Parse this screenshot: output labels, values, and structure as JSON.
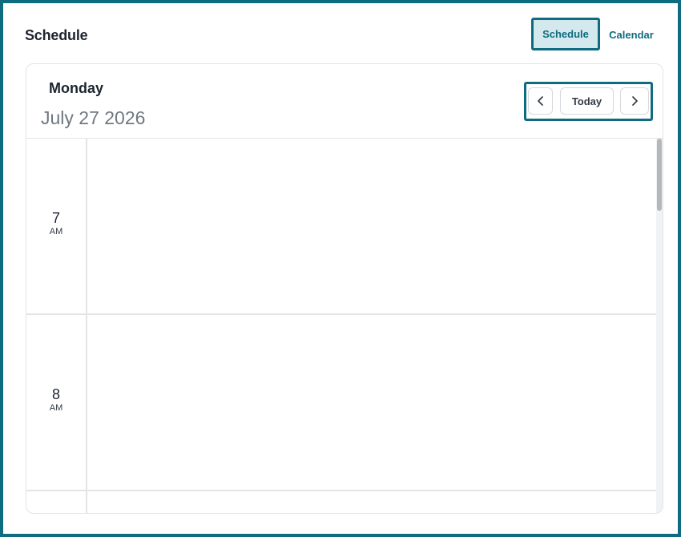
{
  "header": {
    "title": "Schedule",
    "views": {
      "schedule_label": "Schedule",
      "calendar_label": "Calendar",
      "selected": "Schedule"
    }
  },
  "day_view": {
    "day_name": "Monday",
    "date": "July 27 2026",
    "nav": {
      "prev_icon": "chevron-left-icon",
      "today_label": "Today",
      "next_icon": "chevron-right-icon"
    },
    "hours": [
      {
        "hour": "7",
        "period": "AM"
      },
      {
        "hour": "8",
        "period": "AM"
      }
    ]
  },
  "colors": {
    "accent": "#0f6b7f",
    "selected_bg": "#d3e9ed",
    "grid_line": "#e2e4e6"
  }
}
